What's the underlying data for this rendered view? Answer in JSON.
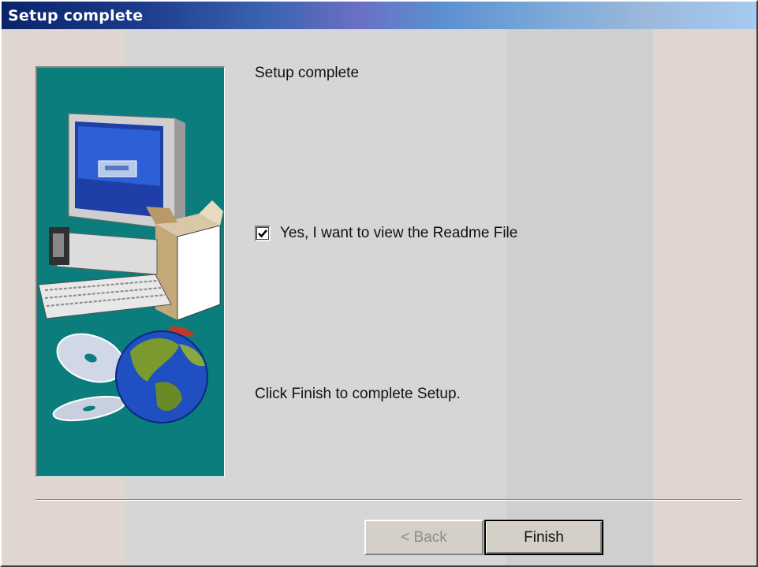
{
  "window": {
    "title": "Setup complete"
  },
  "main": {
    "heading": "Setup complete",
    "checkbox": {
      "label": "Yes, I want to view the Readme File",
      "checked": true
    },
    "instruction": "Click Finish to complete Setup."
  },
  "buttons": {
    "back_label": "< Back",
    "back_enabled": false,
    "finish_label": "Finish"
  },
  "side_panel": {
    "icon": "computer-globe-illustration",
    "background_color": "#0b7d7d"
  },
  "colors": {
    "title_gradient_start": "#0a246a",
    "title_gradient_end": "#a6caf0",
    "dialog_face": "#d6d6d6"
  }
}
